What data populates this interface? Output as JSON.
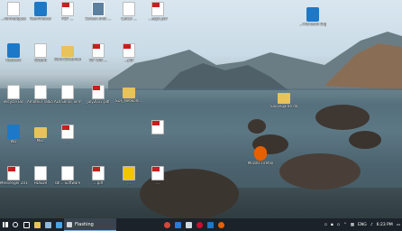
{
  "desktop_icons": [
    {
      "name": "desktop-icon-informatiques",
      "label": "...formatiques",
      "kind": "doc"
    },
    {
      "name": "desktop-icon-teamviewer",
      "label": "TeamViewer",
      "kind": "app-blue"
    },
    {
      "name": "desktop-icon-pdf-1",
      "label": "PDF ...",
      "kind": "pdf"
    },
    {
      "name": "desktop-icon-image-1",
      "label": "Screen shot ...",
      "kind": "shot"
    },
    {
      "name": "desktop-icon-doc-1",
      "label": "Calcul ...",
      "kind": "doc"
    },
    {
      "name": "desktop-icon-pdf-2",
      "label": "...aspx.pdf",
      "kind": "pdf"
    },
    {
      "name": "desktop-icon-network",
      "label": "Network",
      "kind": "app-blue"
    },
    {
      "name": "desktop-icon-wizard",
      "label": "Wizard",
      "kind": "doc"
    },
    {
      "name": "desktop-icon-word-doc",
      "label": "Word Document",
      "kind": "folder"
    },
    {
      "name": "desktop-icon-pdf-3",
      "label": "WF Wifi ...",
      "kind": "pdf"
    },
    {
      "name": "desktop-icon-pdf-4",
      "label": "...pdf",
      "kind": "pdf"
    },
    {
      "name": "desktop-icon-recycle-bin",
      "label": "Recycle Bin",
      "kind": "doc"
    },
    {
      "name": "desktop-icon-amateur-radio",
      "label": "Amateur radio pl...",
      "kind": "doc"
    },
    {
      "name": "desktop-icon-adi-terminal",
      "label": "ADI Serial Terminal",
      "kind": "doc"
    },
    {
      "name": "desktop-icon-pdf-5",
      "label": "July2017.pdf",
      "kind": "pdf"
    },
    {
      "name": "desktop-icon-sdf-network",
      "label": "SDF_Network...",
      "kind": "folder"
    },
    {
      "name": "desktop-icon-wd",
      "label": "WD",
      "kind": "app-blue"
    },
    {
      "name": "desktop-icon-misc",
      "label": "Misc",
      "kind": "folder"
    },
    {
      "name": "desktop-icon-pdf-6",
      "label": "...",
      "kind": "pdf"
    },
    {
      "name": "desktop-icon-pdf-7",
      "label": "...",
      "kind": "pdf"
    },
    {
      "name": "desktop-icon-messenger-pdf",
      "label": "Messenger 2017-11.pdf",
      "kind": "pdf"
    },
    {
      "name": "desktop-icon-hdsdr",
      "label": "HDSDR",
      "kind": "doc"
    },
    {
      "name": "desktop-icon-sdr-software",
      "label": "sdr... Software",
      "kind": "doc"
    },
    {
      "name": "desktop-icon-pdf-8",
      "label": "...pdf",
      "kind": "pdf"
    },
    {
      "name": "desktop-icon-media",
      "label": "...",
      "kind": "doc"
    },
    {
      "name": "desktop-icon-pdf-9",
      "label": "...",
      "kind": "pdf"
    },
    {
      "name": "desktop-icon-edge",
      "label": "...Microsoft Edge",
      "kind": "app-blue"
    },
    {
      "name": "desktop-icon-folder-right",
      "label": "Sauvegarde documents",
      "kind": "folder"
    },
    {
      "name": "desktop-icon-firefox",
      "label": "Mozilla Firefox",
      "kind": "app-blue"
    }
  ],
  "taskbar": {
    "active_task": "Flashing",
    "language": "ENG",
    "clock": "6:23 PM"
  }
}
